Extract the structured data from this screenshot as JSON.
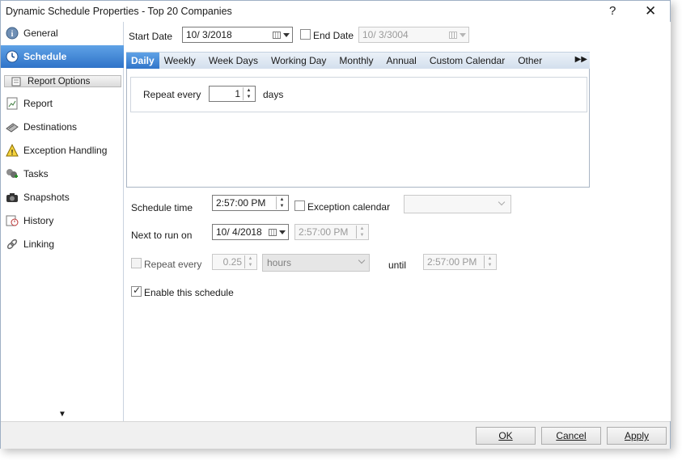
{
  "window": {
    "title": "Dynamic Schedule Properties - Top 20 Companies",
    "help": "?",
    "close": "✕"
  },
  "sidebar": {
    "items": [
      {
        "label": "General",
        "icon": "info-icon"
      },
      {
        "label": "Schedule",
        "icon": "clock-icon"
      },
      {
        "label": "Report Options",
        "icon": "report-options-icon"
      },
      {
        "label": "Report",
        "icon": "report-icon"
      },
      {
        "label": "Destinations",
        "icon": "destinations-icon"
      },
      {
        "label": "Exception Handling",
        "icon": "warning-icon"
      },
      {
        "label": "Tasks",
        "icon": "tasks-icon"
      },
      {
        "label": "Snapshots",
        "icon": "camera-icon"
      },
      {
        "label": "History",
        "icon": "history-icon"
      },
      {
        "label": "Linking",
        "icon": "link-icon"
      }
    ],
    "scroll_down": "▼"
  },
  "schedule": {
    "start_date_label": "Start Date",
    "start_date": "10/  3/2018",
    "end_date_label": "End Date",
    "end_date": "10/  3/3004",
    "tabs": [
      "Daily",
      "Weekly",
      "Week Days",
      "Working Day",
      "Monthly",
      "Annual",
      "Custom Calendar",
      "Other"
    ],
    "tabs_more": "▶▶",
    "repeat_every_label": "Repeat every",
    "repeat_every_value": "1",
    "repeat_every_unit": "days",
    "schedule_time_label": "Schedule time",
    "schedule_time": "2:57:00 PM",
    "exception_calendar_label": "Exception calendar",
    "next_run_label": "Next to run on",
    "next_run_date": "10/  4/2018",
    "next_run_time": "2:57:00 PM",
    "repeat2_label": "Repeat every",
    "repeat2_value": "0.25",
    "repeat2_unit": "hours",
    "until_label": "until",
    "until_time": "2:57:00 PM",
    "enable_label": "Enable this schedule"
  },
  "buttons": {
    "ok": "OK",
    "cancel": "Cancel",
    "apply": "Apply"
  },
  "colors": {
    "accent": "#2f73c8",
    "tab_strip": "#d3dfed"
  }
}
